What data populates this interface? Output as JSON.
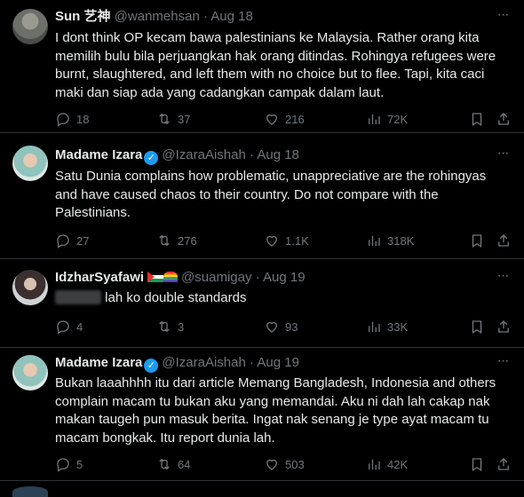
{
  "tweets": [
    {
      "name": "Sun 艺神",
      "handle": "@wanmehsan",
      "date": "· Aug 18",
      "verified": false,
      "text": "I dont think OP kecam bawa palestinians ke Malaysia. Rather orang kita memilih bulu bila perjuangkan hak orang ditindas. Rohingya refugees were burnt, slaughtered, and left them with no choice but to flee. Tapi, kita caci maki dan siap ada yang cadangkan campak dalam laut.",
      "replies": "18",
      "retweets": "37",
      "likes": "216",
      "views": "72K"
    },
    {
      "name": "Madame Izara",
      "handle": "@IzaraAishah",
      "date": "· Aug 18",
      "verified": true,
      "text": "Satu Dunia complains how problematic, unappreciative are the rohingyas and have caused chaos to their country. Do not compare with the Palestinians.",
      "replies": "27",
      "retweets": "276",
      "likes": "1.1K",
      "views": "318K"
    },
    {
      "name": "IdzharSyafawi",
      "handle": "@suamigay",
      "date": "· Aug 19",
      "verified": false,
      "text": "lah ko double standards",
      "replies": "4",
      "retweets": "3",
      "likes": "93",
      "views": "33K"
    },
    {
      "name": "Madame Izara",
      "handle": "@IzaraAishah",
      "date": "· Aug 19",
      "verified": true,
      "text": "Bukan laaahhhh itu dari article Memang Bangladesh, Indonesia and others complain macam tu bukan aku yang memandai. Aku ni dah lah cakap nak makan taugeh pun masuk berita. Ingat nak senang je type ayat macam tu macam bongkak. Itu report dunia lah.",
      "replies": "5",
      "retweets": "64",
      "likes": "503",
      "views": "42K"
    }
  ],
  "icons": {
    "reply": "reply-icon",
    "retweet": "retweet-icon",
    "like": "heart-icon",
    "views": "views-icon",
    "bookmark": "bookmark-icon",
    "share": "share-icon",
    "more": "more-icon"
  },
  "colors": {
    "background": "#000000",
    "text": "#e7e9ea",
    "muted": "#71767b",
    "verified": "#1d9bf0",
    "border": "#2f3336"
  }
}
